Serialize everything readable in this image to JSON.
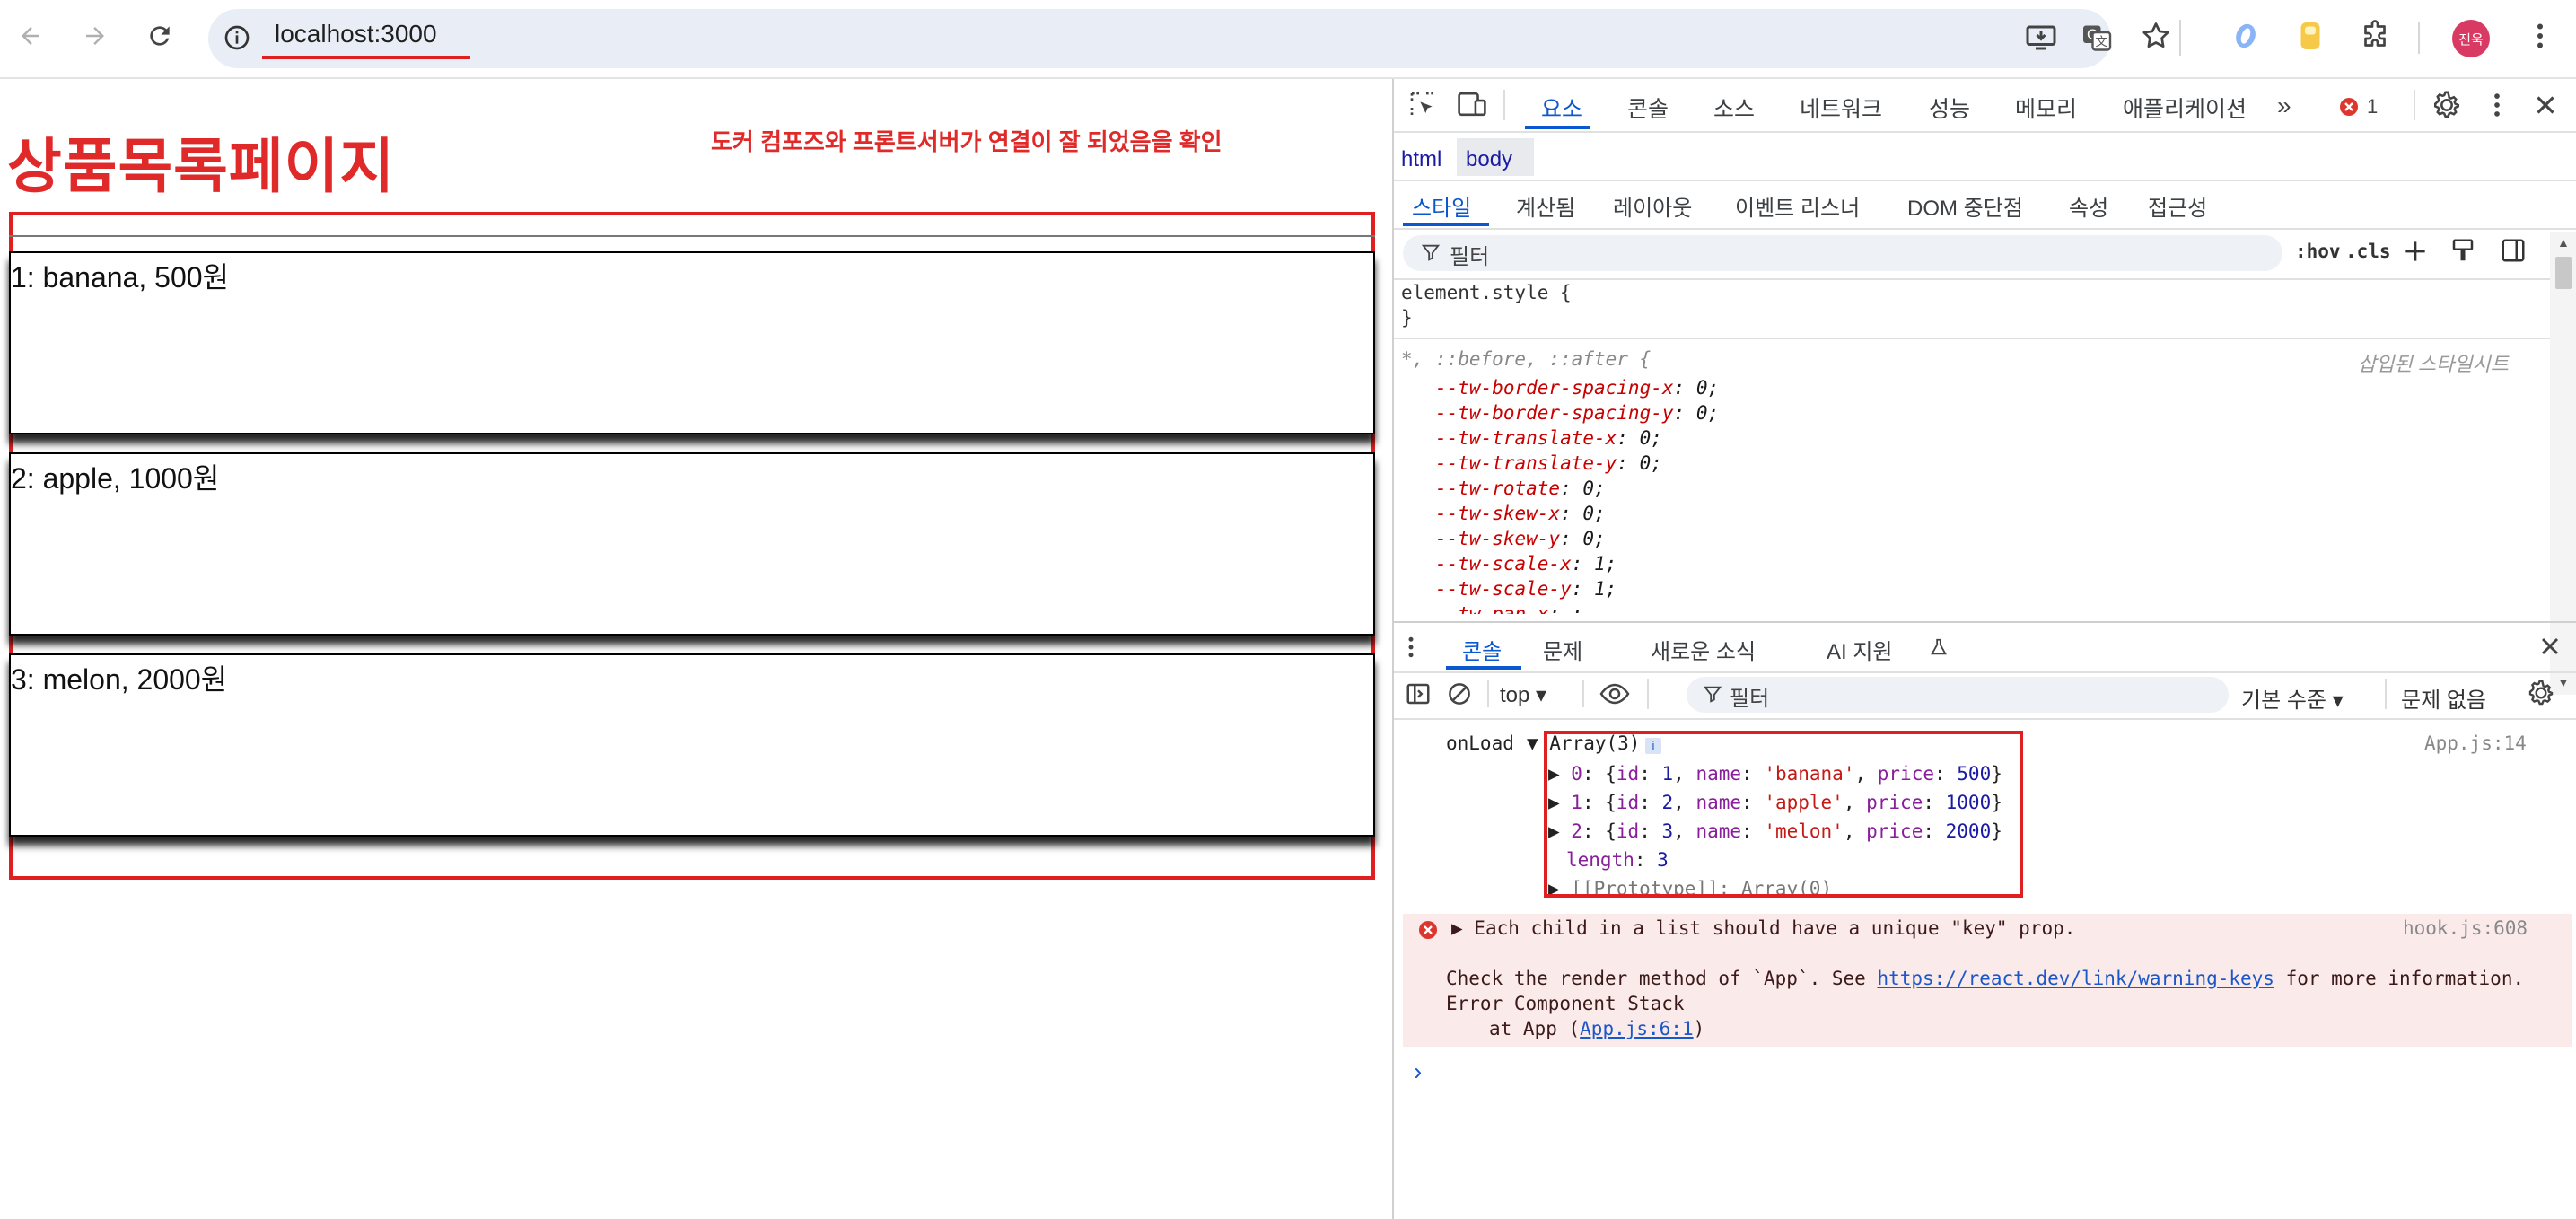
{
  "browser": {
    "url": "localhost:3000",
    "profile_initials": "진욱"
  },
  "page": {
    "title": "상품목록페이지",
    "annotation": "도커 컴포즈와 프론트서버가 연결이 잘 되었음을 확인",
    "items": [
      {
        "label": "1: banana, 500원"
      },
      {
        "label": "2: apple, 1000원"
      },
      {
        "label": "3: melon, 2000원"
      }
    ]
  },
  "devtools": {
    "tabs": [
      "요소",
      "콘솔",
      "소스",
      "네트워크",
      "성능",
      "메모리",
      "애플리케이션"
    ],
    "active_tab": "요소",
    "error_count": "1",
    "breadcrumbs": [
      "html",
      "body"
    ],
    "style_tabs": [
      "스타일",
      "계산됨",
      "레이아웃",
      "이벤트 리스너",
      "DOM 중단점",
      "속성",
      "접근성"
    ],
    "filter_placeholder": "필터",
    "hov": ":hov",
    "cls": ".cls",
    "element_style": "element.style {",
    "close_brace": "}",
    "selector": "*, ::before, ::after {",
    "injected_label": "삽입된 스타일시트",
    "css_props": [
      {
        "name": "--tw-border-spacing-x",
        "value": "0;"
      },
      {
        "name": "--tw-border-spacing-y",
        "value": "0;"
      },
      {
        "name": "--tw-translate-x",
        "value": "0;"
      },
      {
        "name": "--tw-translate-y",
        "value": "0;"
      },
      {
        "name": "--tw-rotate",
        "value": "0;"
      },
      {
        "name": "--tw-skew-x",
        "value": "0;"
      },
      {
        "name": "--tw-skew-y",
        "value": "0;"
      },
      {
        "name": "--tw-scale-x",
        "value": "1;"
      },
      {
        "name": "--tw-scale-y",
        "value": "1;"
      },
      {
        "name": "--tw-pan-x",
        "value": ";"
      }
    ],
    "drawer_tabs": [
      "콘솔",
      "문제",
      "새로운 소식",
      "AI 지원"
    ],
    "context": "top",
    "console_filter": "필터",
    "level": "기본 수준",
    "no_issues": "문제 없음",
    "log": {
      "prefix": "onLoad",
      "array_label": "Array(3)",
      "source": "App.js:14",
      "entries": [
        {
          "index": "0",
          "id": "1",
          "name": "'banana'",
          "price": "500"
        },
        {
          "index": "1",
          "id": "2",
          "name": "'apple'",
          "price": "1000"
        },
        {
          "index": "2",
          "id": "3",
          "name": "'melon'",
          "price": "2000"
        }
      ],
      "length_key": "length",
      "length_value": "3",
      "prototype": "[[Prototype]]: Array(0)"
    },
    "error": {
      "message": "Each child in a list should have a unique \"key\" prop.",
      "source": "hook.js:608",
      "line2_before": "Check the render method of `App`. See ",
      "link": "https://react.dev/link/warning-keys",
      "line2_after": " for more information.",
      "line3": "Error Component Stack",
      "line4_before": "at App (",
      "line4_link": "App.js:6:1",
      "line4_after": ")"
    },
    "prompt": "›"
  }
}
